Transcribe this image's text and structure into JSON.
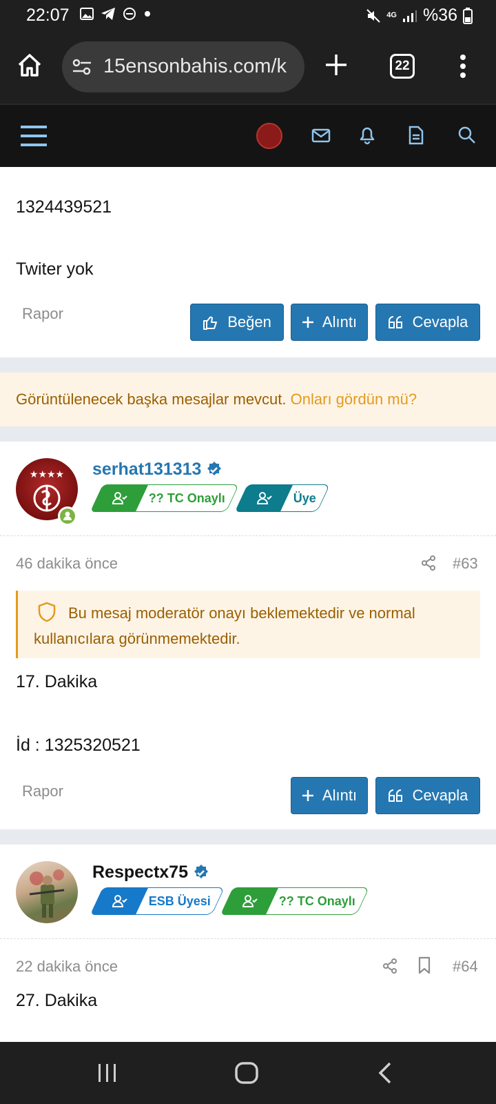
{
  "status_bar": {
    "time": "22:07",
    "network": "4G",
    "battery": "%36"
  },
  "browser": {
    "url": "15ensonbahis.com/k",
    "tab_count": "22"
  },
  "post_top": {
    "lines": [
      "1324439521",
      "Twiter yok"
    ],
    "report": "Rapor",
    "buttons": {
      "like": "Beğen",
      "quote": "Alıntı",
      "reply": "Cevapla"
    }
  },
  "notice": {
    "text": "Görüntülenecek başka mesajlar mevcut.",
    "link": "Onları gördün mü?"
  },
  "post_63": {
    "username": "serhat131313",
    "badges": [
      "?? TC Onaylı",
      "Üye"
    ],
    "time": "46 dakika önce",
    "number": "#63",
    "moderation_warning": "Bu mesaj moderatör onayı beklemektedir ve normal kullanıcılara görünmemektedir.",
    "lines": [
      "17. Dakika",
      "İd : 1325320521"
    ],
    "report": "Rapor",
    "buttons": {
      "quote": "Alıntı",
      "reply": "Cevapla"
    }
  },
  "post_64": {
    "username": "Respectx75",
    "badges": [
      "ESB Üyesi",
      "?? TC Onaylı"
    ],
    "time": "22 dakika önce",
    "number": "#64",
    "lines": [
      "27. Dakika"
    ]
  },
  "colors": {
    "accent": "#2577b1",
    "green_badge": "#2e9e3a",
    "teal_badge": "#0d7c8c",
    "blue_badge": "#1779c9",
    "notice_bg": "#fef4e6",
    "notice_link": "#e39a1c"
  }
}
